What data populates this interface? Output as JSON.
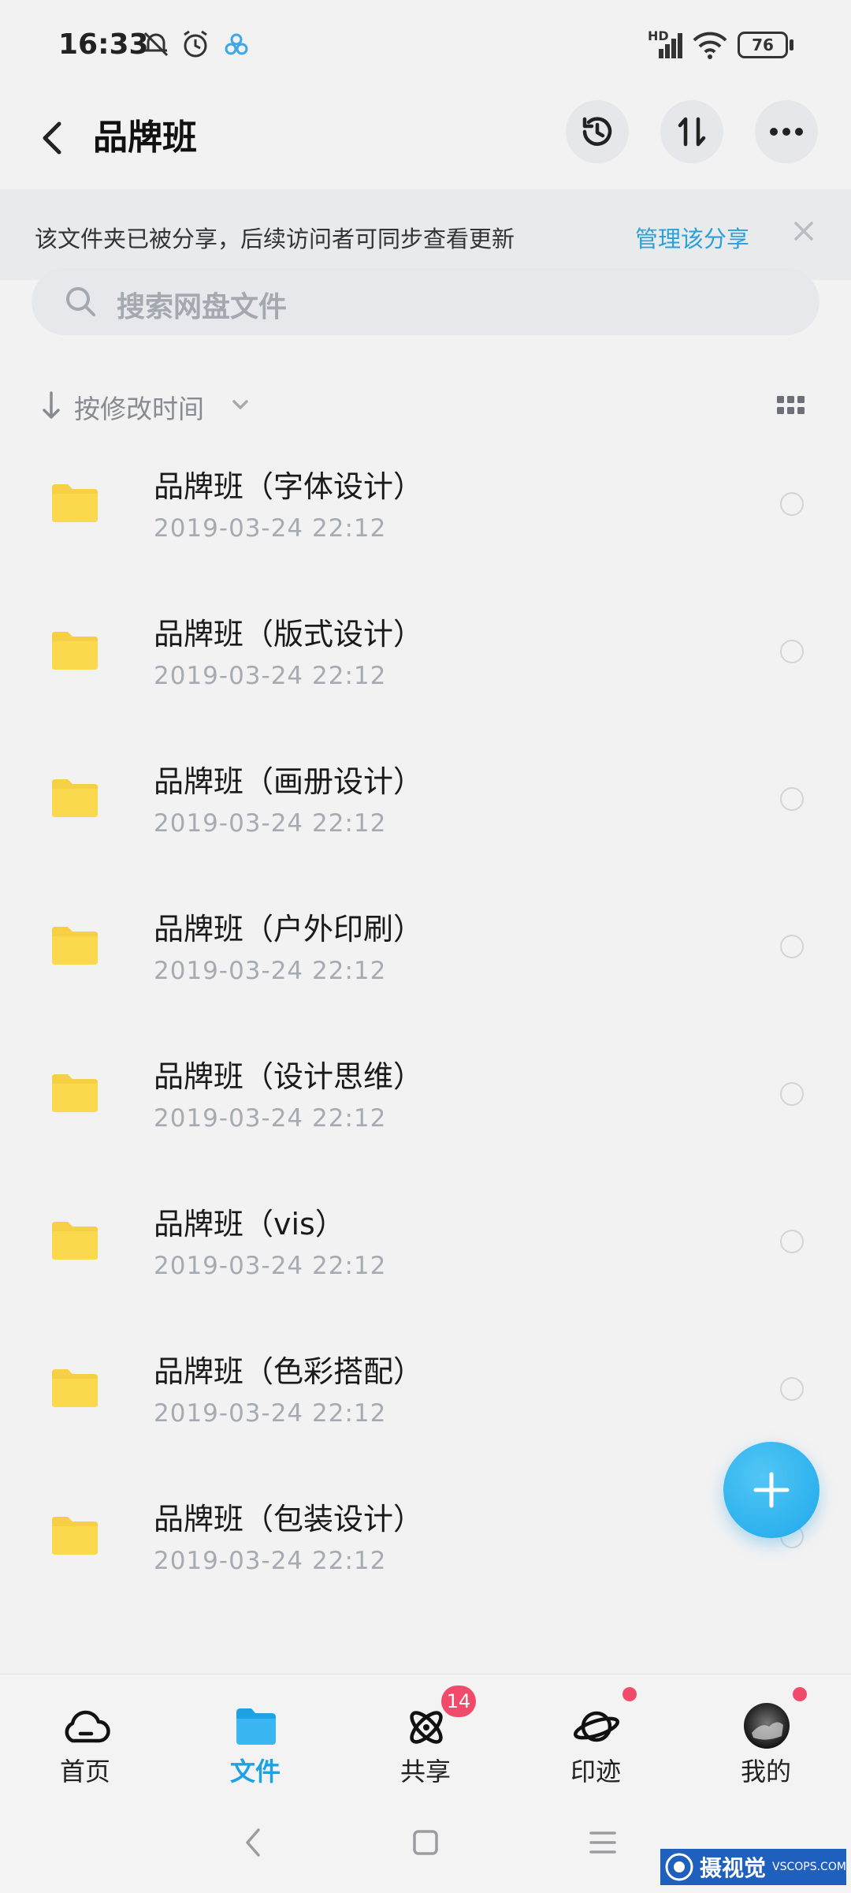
{
  "status_bar": {
    "time": "16:33",
    "battery": "76",
    "network_label": "HD"
  },
  "header": {
    "title": "品牌班",
    "back_icon": "chevron-left-icon",
    "actions": [
      "history-icon",
      "sort-arrows-icon",
      "more-icon"
    ]
  },
  "share_banner": {
    "text": "该文件夹已被分享，后续访问者可同步查看更新",
    "manage_label": "管理该分享",
    "accent": "#2aa1d8"
  },
  "search": {
    "placeholder": "搜索网盘文件"
  },
  "sort": {
    "label": "按修改时间"
  },
  "files": [
    {
      "name": "品牌班（字体设计）",
      "date": "2019-03-24  22:12"
    },
    {
      "name": "品牌班（版式设计）",
      "date": "2019-03-24  22:12"
    },
    {
      "name": "品牌班（画册设计）",
      "date": "2019-03-24  22:12"
    },
    {
      "name": "品牌班（户外印刷）",
      "date": "2019-03-24  22:12"
    },
    {
      "name": "品牌班（设计思维）",
      "date": "2019-03-24  22:12"
    },
    {
      "name": "品牌班（vis）",
      "date": "2019-03-24  22:12"
    },
    {
      "name": "品牌班（色彩搭配）",
      "date": "2019-03-24  22:12"
    },
    {
      "name": "品牌班（包装设计）",
      "date": "2019-03-24  22:12"
    }
  ],
  "bottom_nav": {
    "items": [
      {
        "label": "首页",
        "icon": "cloud-icon"
      },
      {
        "label": "文件",
        "icon": "folder-icon",
        "active": true
      },
      {
        "label": "共享",
        "icon": "orbit-icon",
        "badge": "14"
      },
      {
        "label": "印迹",
        "icon": "planet-icon",
        "dot": true
      },
      {
        "label": "我的",
        "icon": "avatar-icon",
        "dot": true
      }
    ],
    "active_color": "#1fa2e3",
    "badge_color": "#f04b6a"
  },
  "watermark": {
    "text": "摄视觉",
    "sub": "VSCOPS.COM"
  }
}
